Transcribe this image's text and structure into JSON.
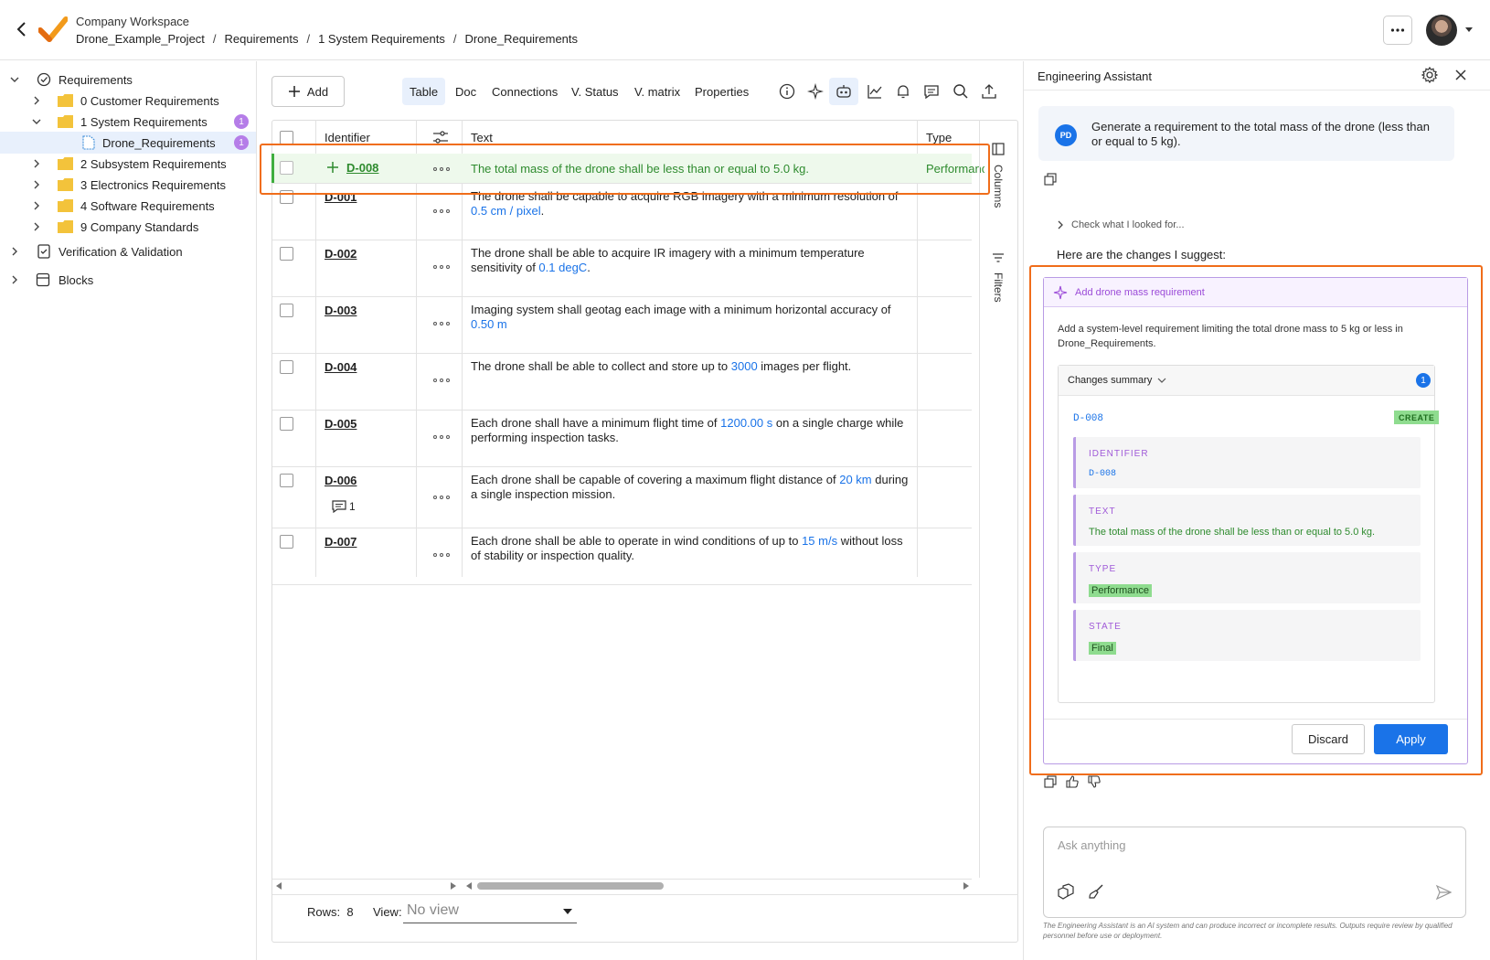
{
  "header": {
    "workspace": "Company Workspace",
    "breadcrumb": [
      "Drone_Example_Project",
      "Requirements",
      "1 System Requirements",
      "Drone_Requirements"
    ],
    "separator": "/"
  },
  "sidebar": {
    "root": "Requirements",
    "folders": [
      {
        "label": "0 Customer Requirements"
      },
      {
        "label": "1 System Requirements",
        "badge": "1"
      },
      {
        "label": "Drone_Requirements",
        "badge": "1"
      },
      {
        "label": "2 Subsystem Requirements"
      },
      {
        "label": "3 Electronics Requirements"
      },
      {
        "label": "4 Software Requirements"
      },
      {
        "label": "9 Company Standards"
      }
    ],
    "sections": [
      "Verification & Validation",
      "Blocks"
    ]
  },
  "toolbar": {
    "add_label": "Add",
    "tabs": [
      "Table",
      "Doc",
      "Connections",
      "V. Status",
      "V. matrix",
      "Properties"
    ],
    "active_tab": "Table",
    "icons": [
      "info-icon",
      "sparkle-icon",
      "robot-icon",
      "chart-icon",
      "bell-icon",
      "comment-icon",
      "search-icon",
      "upload-icon"
    ]
  },
  "table": {
    "headers": {
      "identifier": "Identifier",
      "text": "Text",
      "type": "Type"
    },
    "side_tabs": [
      "Columns",
      "Filters"
    ],
    "new_row": {
      "id": "D-008",
      "text": "The total mass of the drone shall be less than or equal to 5.0 kg.",
      "type": "Performanc"
    },
    "rows": [
      {
        "id": "D-001",
        "pre": "The drone shall be capable to acquire RGB imagery with a minimum resolution of ",
        "val": "0.5  cm / pixel",
        "post": "."
      },
      {
        "id": "D-002",
        "pre": "The drone shall be able to acquire IR imagery with a minimum temperature sensitivity of ",
        "val": "0.1  degC",
        "post": "."
      },
      {
        "id": "D-003",
        "pre": "Imaging system shall geotag each image with a minimum horizontal accuracy of ",
        "val": "0.50  m",
        "post": ""
      },
      {
        "id": "D-004",
        "pre": "The drone shall be able to collect and store up to ",
        "val": "3000",
        "post": " images per flight."
      },
      {
        "id": "D-005",
        "pre": "Each drone shall have a minimum flight time of ",
        "val": "1200.00  s",
        "post": " on a single charge while performing inspection tasks."
      },
      {
        "id": "D-006",
        "pre": "Each drone shall be capable of covering a maximum flight distance of ",
        "val": "20  km",
        "post": " during a single inspection mission.",
        "comments": "1"
      },
      {
        "id": "D-007",
        "pre": "Each drone shall be able to operate in wind conditions of up to ",
        "val": "15  m/s",
        "post": " without loss of stability or inspection quality."
      }
    ],
    "footer": {
      "rows_label": "Rows:",
      "rows_count": "8",
      "view_label": "View:",
      "view_value": "No view"
    }
  },
  "assistant": {
    "title": "Engineering Assistant",
    "user_initials": "PD",
    "user_message": "Generate a requirement to the total mass of the drone (less than or equal to 5 kg).",
    "check_looked": "Check what I looked for...",
    "intro": "Here are the changes I suggest:",
    "suggestion": {
      "title": "Add drone mass requirement",
      "description": "Add a system-level requirement limiting the total drone mass to 5 kg or less in Drone_Requirements.",
      "summary_label": "Changes summary",
      "summary_count": "1",
      "change_id": "D-008",
      "change_tag": "CREATE",
      "fields": [
        {
          "label": "IDENTIFIER",
          "value": "D-008"
        },
        {
          "label": "TEXT",
          "value": "The total mass of the drone shall be less than or equal to 5.0 kg."
        },
        {
          "label": "TYPE",
          "value": "Performance"
        },
        {
          "label": "STATE",
          "value": "Final"
        }
      ],
      "discard_label": "Discard",
      "apply_label": "Apply"
    },
    "ask_placeholder": "Ask anything",
    "disclaimer": "The Engineering Assistant is an AI system and can produce incorrect or incomplete results. Outputs require review by qualified personnel before use or deployment."
  },
  "colors": {
    "accent": "#1a73e8",
    "highlight": "#f06d1a",
    "new_row_bg": "#eef9ec",
    "new_row_text": "#2e8b2e",
    "badge": "#b57de8",
    "suggestion": "#9b4bd8"
  }
}
